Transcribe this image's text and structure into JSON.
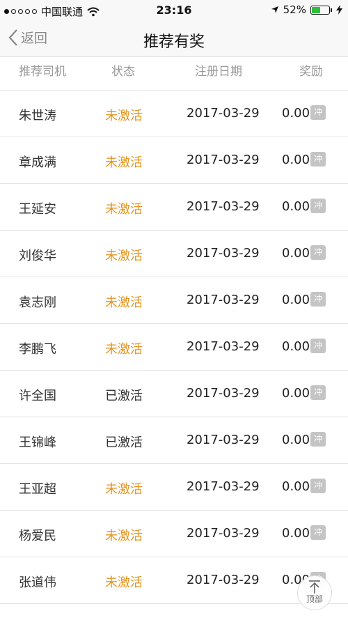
{
  "status_bar": {
    "carrier": "中国联通",
    "time": "23:16",
    "battery": "52%",
    "battery_level": 0.52
  },
  "nav": {
    "back_label": "返回",
    "title": "推荐有奖"
  },
  "table": {
    "headers": [
      "推荐司机",
      "状态",
      "注册日期",
      "奖励"
    ],
    "charge_label": "冲",
    "rows": [
      {
        "name": "朱世涛",
        "status": "未激活",
        "date": "2017-03-29",
        "reward": "0.00"
      },
      {
        "name": "章成满",
        "status": "未激活",
        "date": "2017-03-29",
        "reward": "0.00"
      },
      {
        "name": "王延安",
        "status": "未激活",
        "date": "2017-03-29",
        "reward": "0.00"
      },
      {
        "name": "刘俊华",
        "status": "未激活",
        "date": "2017-03-29",
        "reward": "0.00"
      },
      {
        "name": "袁志刚",
        "status": "未激活",
        "date": "2017-03-29",
        "reward": "0.00"
      },
      {
        "name": "李鹏飞",
        "status": "未激活",
        "date": "2017-03-29",
        "reward": "0.00"
      },
      {
        "name": "许全国",
        "status": "已激活",
        "date": "2017-03-29",
        "reward": "0.00"
      },
      {
        "name": "王锦峰",
        "status": "已激活",
        "date": "2017-03-29",
        "reward": "0.00"
      },
      {
        "name": "王亚超",
        "status": "未激活",
        "date": "2017-03-29",
        "reward": "0.00"
      },
      {
        "name": "杨爱民",
        "status": "未激活",
        "date": "2017-03-29",
        "reward": "0.00"
      },
      {
        "name": "张道伟",
        "status": "未激活",
        "date": "2017-03-29",
        "reward": "0.00"
      }
    ]
  },
  "to_top_label": "顶部",
  "colors": {
    "inactive_status": "#e6951e",
    "battery_green": "#2dbf3a"
  }
}
